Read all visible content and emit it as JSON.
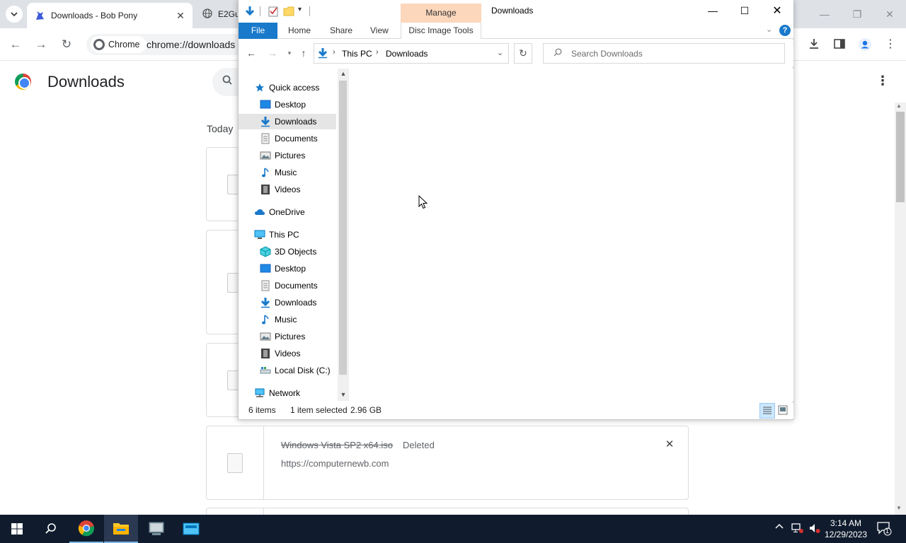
{
  "chrome": {
    "active_tab_title": "Downloads - Bob Pony",
    "second_tab_title": "E2Gu",
    "tab_close": "✕",
    "omnibox_chip": "Chrome",
    "url": "chrome://downloads",
    "page_title": "Downloads",
    "today_label": "Today",
    "download": {
      "file_name": "Windows Vista SP2 x64.iso",
      "status": "Deleted",
      "source_url": "https://computernewb.com",
      "remove": "✕"
    }
  },
  "explorer": {
    "window_title": "Downloads",
    "contextual_group": "Manage",
    "ribbon_tabs": {
      "file": "File",
      "home": "Home",
      "share": "Share",
      "view": "View",
      "disc_image_tools": "Disc Image Tools"
    },
    "breadcrumb": [
      "This PC",
      "Downloads"
    ],
    "search_placeholder": "Search Downloads",
    "nav_pane": {
      "quick_access": "Quick access",
      "quick_items": [
        "Desktop",
        "Downloads",
        "Documents",
        "Pictures",
        "Music",
        "Videos"
      ],
      "onedrive": "OneDrive",
      "this_pc": "This PC",
      "pc_items": [
        "3D Objects",
        "Desktop",
        "Documents",
        "Downloads",
        "Music",
        "Pictures",
        "Videos",
        "Local Disk (C:)"
      ],
      "network": "Network"
    },
    "status": {
      "count": "6 items",
      "selected": "1 item selected",
      "size": "2.96 GB"
    }
  },
  "taskbar": {
    "time": "3:14 AM",
    "date": "12/29/2023",
    "notification_count": "1"
  }
}
